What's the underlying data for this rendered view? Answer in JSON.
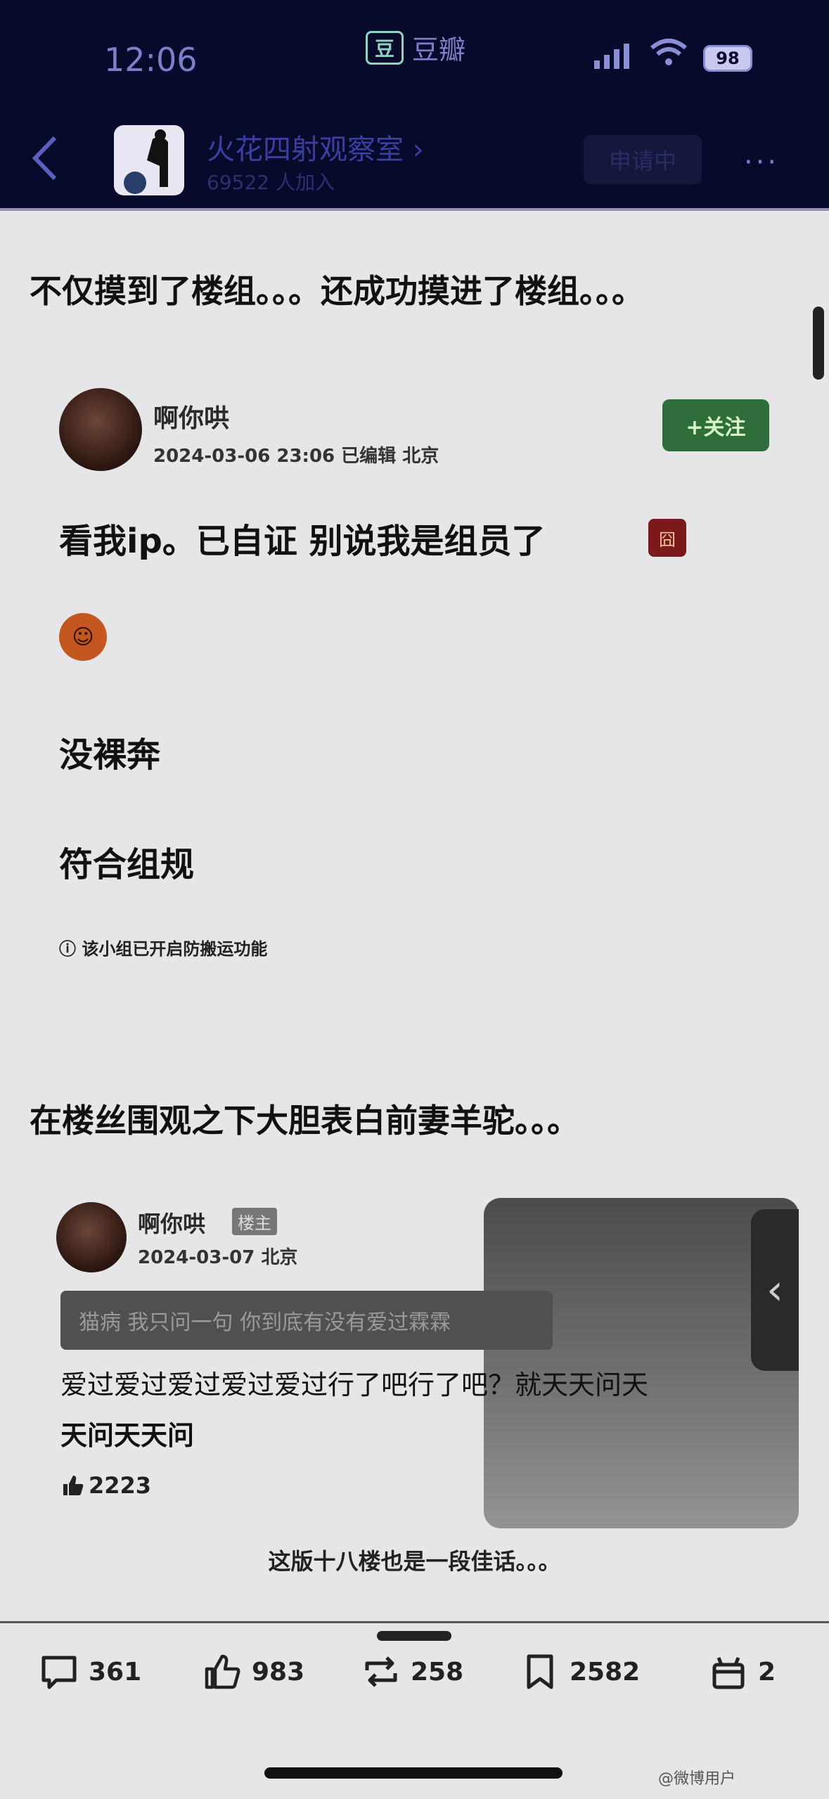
{
  "status_bar": {
    "time": "12:06",
    "app_logo": "豆",
    "app_name": "豆瓣",
    "battery": "98"
  },
  "group": {
    "name": "火花四射观察室",
    "members": "69522 人加入",
    "apply_label": "申请中",
    "more_label": "···"
  },
  "post1": {
    "heading": "不仅摸到了楼组。。。还成功摸进了楼组。。。",
    "author": "啊你哄",
    "meta": "2024-03-06 23:06 已编辑 北京",
    "follow_label": "+关注",
    "lines": [
      "看我ip。已自证 别说我是组员了",
      "没裸奔",
      "符合组规"
    ],
    "notice": "ⓘ 该小组已开启防搬运功能"
  },
  "post2": {
    "heading": "在楼丝围观之下大胆表白前妻羊驼。。。",
    "author": "啊你哄",
    "owner_tag": "楼主",
    "meta": "2024-03-07 北京",
    "quote": "猫病  我只问一句  你到底有没有爱过霖霖",
    "reply_line1": "爱过爱过爱过爱过爱过行了吧行了吧？就天天问天",
    "reply_line2": "天问天天问",
    "likes": "2223",
    "caption": "这版十八楼也是一段佳话。。。"
  },
  "actions": {
    "comments": "361",
    "likes": "983",
    "reposts": "258",
    "collects": "2582",
    "gifts": "2"
  },
  "watermark": "@微博用户"
}
